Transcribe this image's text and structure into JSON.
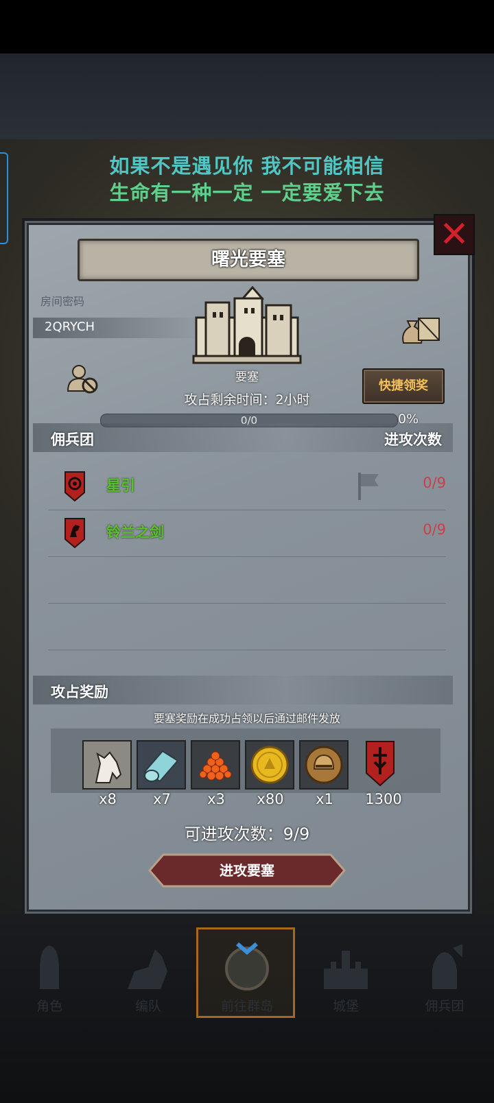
{
  "lyrics": {
    "line1": "如果不是遇见你 我不可能相信",
    "line2": "生命有一种一定 一定要爱下去"
  },
  "panel": {
    "title": "曙光要塞",
    "room_code_label": "房间密码",
    "room_code": "2QRYCH",
    "fortress_label": "要塞",
    "quick_claim_label": "快捷领奖",
    "time_remaining": "攻占剩余时间：2小时",
    "progress_text": "0/0",
    "progress_fraction": 0,
    "progress_percent": "0%"
  },
  "guild_section": {
    "header_left": "佣兵团",
    "header_right": "进攻次数",
    "rows": [
      {
        "name": "星引",
        "count": "0/9"
      },
      {
        "name": "铃兰之剑",
        "count": "0/9"
      }
    ]
  },
  "reward_section": {
    "header": "攻占奖励",
    "hint": "要塞奖励在成功占领以后通过邮件发放",
    "items": [
      {
        "icon": "horse-icon",
        "count": "x8"
      },
      {
        "icon": "cloth-icon",
        "count": "x7"
      },
      {
        "icon": "roe-icon",
        "count": "x3"
      },
      {
        "icon": "gold-coin-icon",
        "count": "x80"
      },
      {
        "icon": "helmet-coin-icon",
        "count": "x1"
      },
      {
        "icon": "banner-icon",
        "count": "1300"
      }
    ]
  },
  "attack": {
    "remaining": "可进攻次数：9/9",
    "button_label": "进攻要塞"
  },
  "nav": {
    "items": [
      {
        "label": "角色"
      },
      {
        "label": "编队"
      },
      {
        "label": "前往群岛"
      },
      {
        "label": "城堡"
      },
      {
        "label": "佣兵团"
      }
    ]
  },
  "colors": {
    "lyric_line1": "#52c6c4",
    "lyric_line2": "#5fd08c",
    "guild_name": "#5ac02c",
    "attack_count": "#c9404a",
    "quick_claim_text": "#f5c25a",
    "close": "#d4202a"
  }
}
